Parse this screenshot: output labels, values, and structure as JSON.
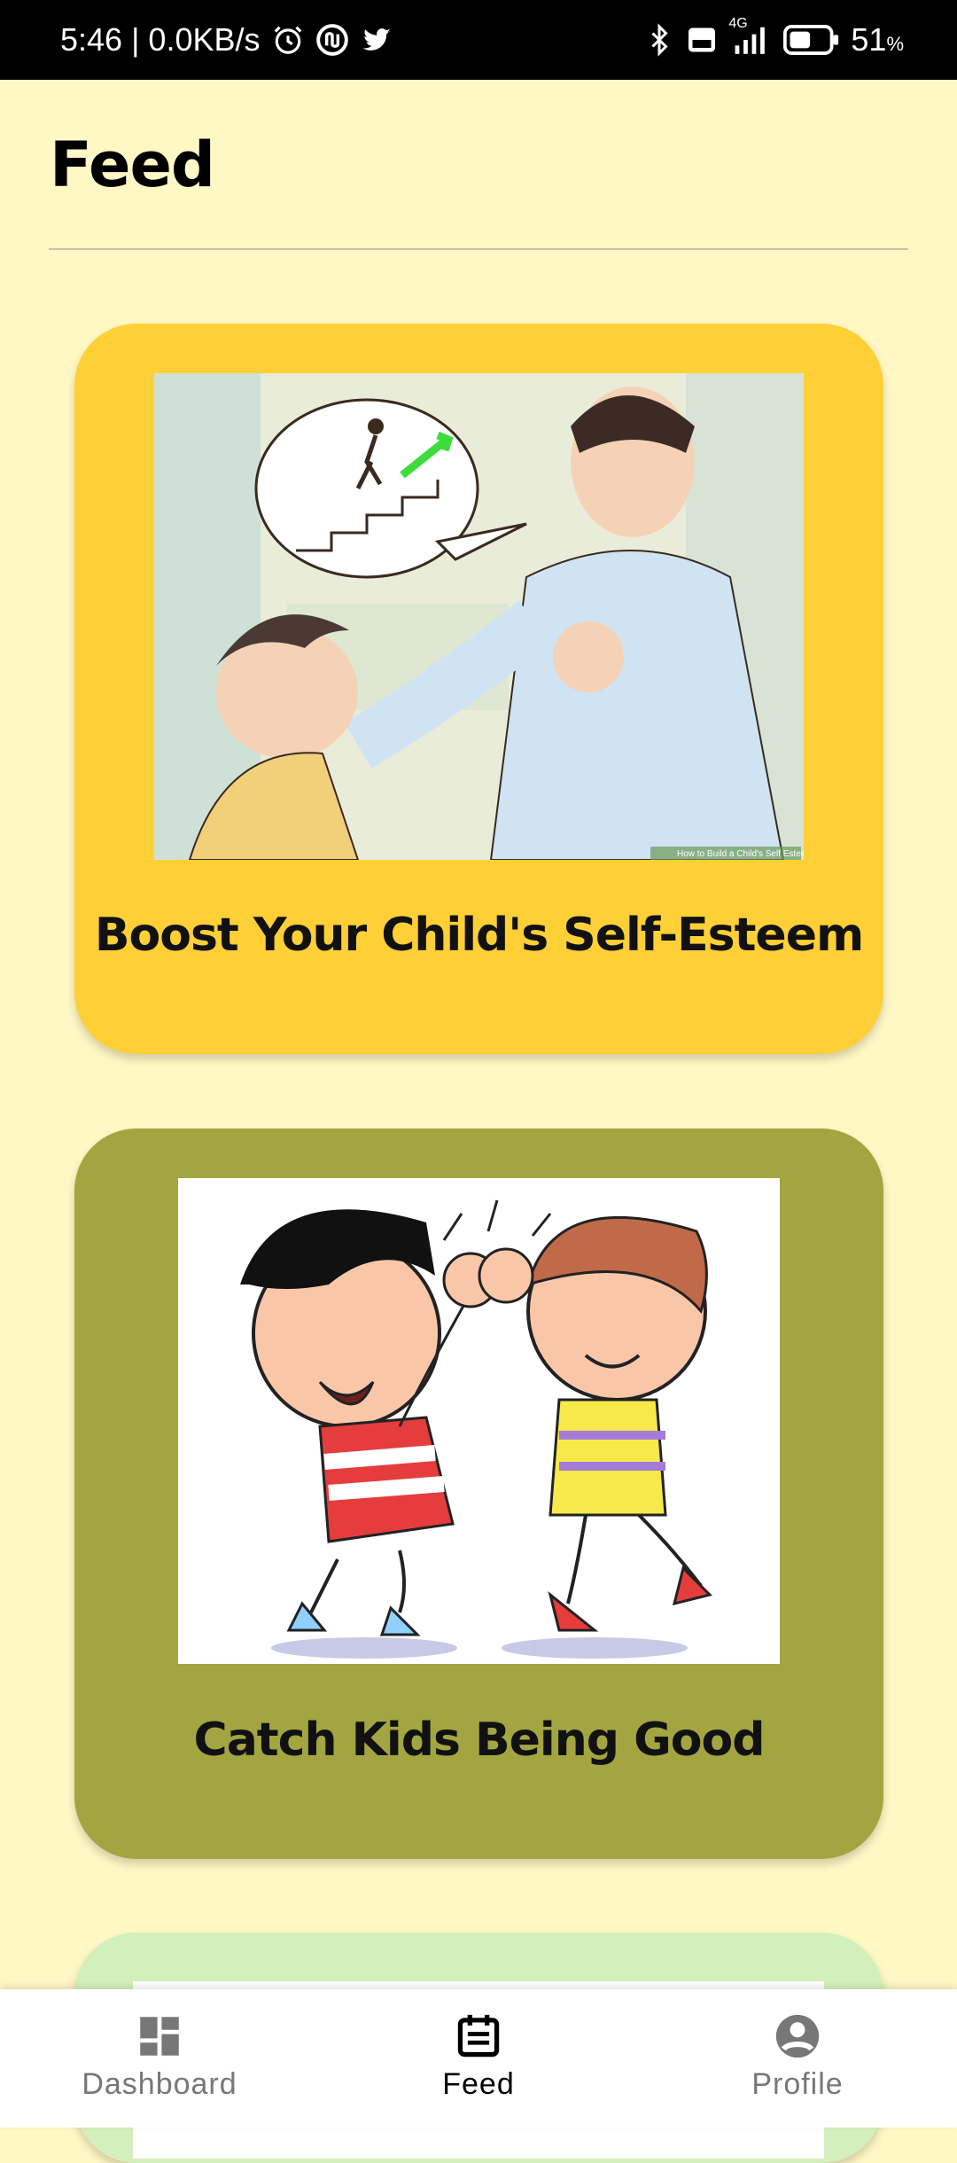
{
  "status_bar": {
    "time_speed": "5:46 | 0.0KB/s",
    "network": "4G",
    "battery_percent": "51",
    "battery_unit": "%",
    "icons": [
      "alarm-icon",
      "app-icon",
      "twitter-icon",
      "bluetooth-icon",
      "volte-icon",
      "signal-icon",
      "battery-icon"
    ]
  },
  "page": {
    "title": "Feed"
  },
  "feed": {
    "cards": [
      {
        "title": "Boost Your Child's Self-Esteem",
        "background": "#FFCF36",
        "watermark": "How to Build a Child's Self Esteem"
      },
      {
        "title": "Catch Kids Being Good",
        "background": "#A3A540"
      },
      {
        "title": "",
        "background": "#D3F0BC"
      }
    ]
  },
  "bottom_nav": {
    "items": [
      {
        "label": "Dashboard",
        "icon": "dashboard-icon",
        "active": false
      },
      {
        "label": "Feed",
        "icon": "feed-icon",
        "active": true
      },
      {
        "label": "Profile",
        "icon": "profile-icon",
        "active": false
      }
    ]
  }
}
